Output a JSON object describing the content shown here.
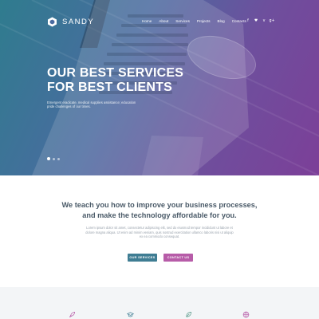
{
  "brand": {
    "name": "SANDY",
    "logo_icon": "hexagon-logo-icon"
  },
  "nav": {
    "items": [
      {
        "label": "Home"
      },
      {
        "label": "About"
      },
      {
        "label": "Services"
      },
      {
        "label": "Projects"
      },
      {
        "label": "Blog"
      },
      {
        "label": "Contacts"
      }
    ],
    "social": [
      {
        "icon": "facebook-icon",
        "glyph": "f"
      },
      {
        "icon": "twitter-icon",
        "glyph": "♥"
      },
      {
        "icon": "vimeo-icon",
        "glyph": "v"
      },
      {
        "icon": "google-plus-icon",
        "glyph": "g+"
      }
    ]
  },
  "hero": {
    "title_line1_pre": "OUR ",
    "title_line1_bold": "BEST",
    "title_line1_post": " SERVICES",
    "title_line2": "FOR BEST CLIENTS",
    "description": "Emergent eradicate, medical supplies assistance; education pride challenges of our times.",
    "slides": {
      "count": 3,
      "active_index": 0
    },
    "gradient_colors": [
      "#2f7c8e",
      "#4a6ba0",
      "#6e4f9d",
      "#7c3f98"
    ]
  },
  "intro": {
    "heading_line1": "We teach you how to improve your business processes,",
    "heading_line2": "and make the technology affordable for you.",
    "text": "Lorem ipsum dolor sit amet, consectetur adipiscing elit, sed do eiusmod tempor incididunt ut labore et dolore magna aliqua. Ut enim ad minim veniam, quis nostrud exercitation ullamco laboris nisi ut aliquip ex ea commodo consequat."
  },
  "buttons": {
    "services_label": "OUR SERVICES",
    "contact_label": "CONTACT US",
    "services_color": "#3f7d93",
    "contact_color": "#b75ca8"
  },
  "features": {
    "icons": [
      "rocket-icon",
      "graduation-cap-icon",
      "leaf-icon",
      "globe-icon"
    ],
    "icon_colors": [
      "#b75ca8",
      "#3f7d93",
      "#5a9a8a",
      "#b75ca8"
    ]
  }
}
